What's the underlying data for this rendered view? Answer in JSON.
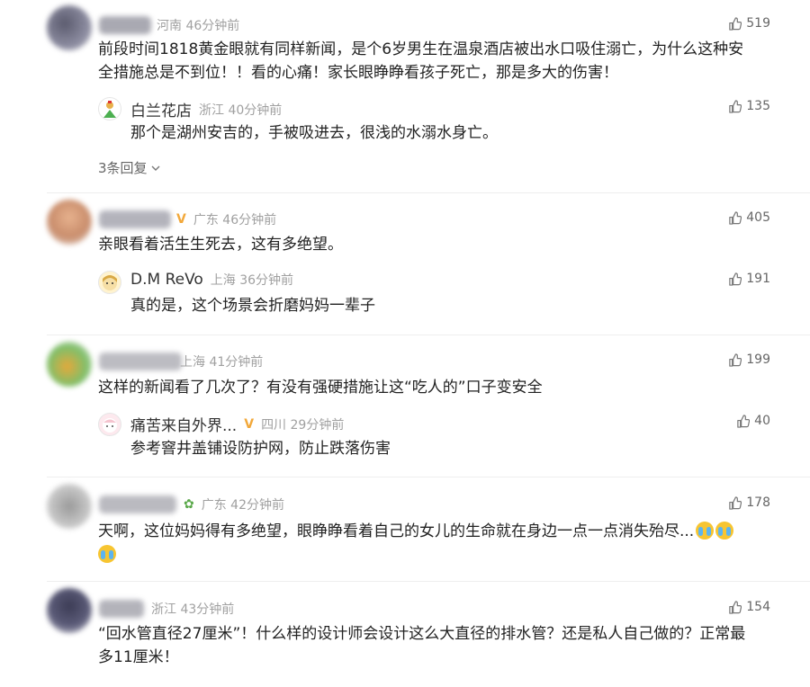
{
  "comments": [
    {
      "meta_suffix": "河南 46分钟前",
      "text_lines": [
        "前段时间1818黄金眼就有同样新闻，是个6岁男生在温泉酒店被出水口吸住溺亡，为什么这种安",
        "全措施总是不到位！！看的心痛！家长眼睁睁看孩子死亡，那是多大的伤害！"
      ],
      "likes": "519",
      "reply": {
        "name": "白兰花店",
        "region_time": "浙江 40分钟前",
        "text": "那个是湖州安吉的，手被吸进去，很浅的水溺水身亡。",
        "likes": "135"
      },
      "more_replies": "3条回复"
    },
    {
      "meta_suffix": "广东 46分钟前",
      "text_lines": [
        "亲眼看着活生生死去，这有多绝望。"
      ],
      "likes": "405",
      "reply": {
        "name": "D.M ReVo",
        "region_time": "上海 36分钟前",
        "text": "真的是，这个场景会折磨妈妈一辈子",
        "likes": "191"
      }
    },
    {
      "meta_suffix": "上海 41分钟前",
      "text_lines": [
        "这样的新闻看了几次了？有没有强硬措施让这“吃人的”口子变安全"
      ],
      "likes": "199",
      "reply": {
        "name": "痛苦来自外界...",
        "region_time": "四川 29分钟前",
        "text": "参考窨井盖铺设防护网，防止跌落伤害",
        "likes": "40"
      }
    },
    {
      "meta_suffix": "广东 42分钟前",
      "text_lines": [
        "天啊，这位妈妈得有多绝望，眼睁睁看着自己的女儿的生命就在身边一点一点消失殆尽..."
      ],
      "likes": "178"
    },
    {
      "meta_suffix": "浙江 43分钟前",
      "text_lines": [
        "“回水管直径27厘米”！什么样的设计师会设计这么大直径的排水管？还是私人自己做的？正常最",
        "多11厘米！"
      ],
      "likes": "154"
    }
  ],
  "icons": {
    "like": "thumbs-up-icon",
    "chevron": "chevron-down-icon",
    "crying": "crying-emoji-icon",
    "vip": "vip-badge-icon"
  },
  "colors": {
    "meta": "#a0a0a0",
    "vip": "#f2a83a",
    "emoji": "#f7c531"
  }
}
